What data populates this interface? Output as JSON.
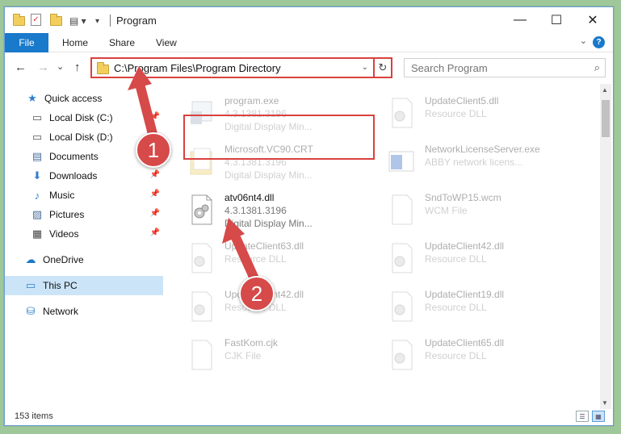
{
  "window": {
    "title": "Program",
    "minimize_glyph": "—",
    "maximize_glyph": "☐",
    "close_glyph": "✕"
  },
  "ribbon": {
    "tabs": [
      "File",
      "Home",
      "Share",
      "View"
    ],
    "help_glyph": "?",
    "accent": "#1979ca"
  },
  "nav": {
    "back_glyph": "←",
    "forward_glyph": "→",
    "recent_glyph": "⌄",
    "up_glyph": "↑",
    "address_path": "C:\\Program Files\\Program Directory",
    "refresh_glyph": "↻",
    "search_placeholder": "Search Program",
    "search_glyph": "⌕"
  },
  "sidebar": {
    "items": [
      {
        "label": "Quick access",
        "icon": "star-icon",
        "glyph": "★",
        "color": "#2f7fd1",
        "pinned": false
      },
      {
        "label": "Local Disk (C:)",
        "icon": "drive-icon",
        "glyph": "▭",
        "color": "#555555",
        "pinned": true
      },
      {
        "label": "Local Disk (D:)",
        "icon": "drive-icon",
        "glyph": "▭",
        "color": "#555555",
        "pinned": false
      },
      {
        "label": "Documents",
        "icon": "documents-icon",
        "glyph": "▤",
        "color": "#4a6f9c",
        "pinned": true
      },
      {
        "label": "Downloads",
        "icon": "downloads-icon",
        "glyph": "⬇",
        "color": "#2f7fd1",
        "pinned": true
      },
      {
        "label": "Music",
        "icon": "music-icon",
        "glyph": "♪",
        "color": "#2f7fd1",
        "pinned": true
      },
      {
        "label": "Pictures",
        "icon": "pictures-icon",
        "glyph": "▨",
        "color": "#4a6f9c",
        "pinned": true
      },
      {
        "label": "Videos",
        "icon": "videos-icon",
        "glyph": "▦",
        "color": "#444444",
        "pinned": true
      },
      {
        "label": "OneDrive",
        "icon": "cloud-icon",
        "glyph": "☁",
        "color": "#1979ca",
        "pinned": false
      },
      {
        "label": "This PC",
        "icon": "computer-icon",
        "glyph": "▭",
        "color": "#2f7fd1",
        "pinned": false,
        "selected": true
      },
      {
        "label": "Network",
        "icon": "network-icon",
        "glyph": "⛁",
        "color": "#2f7fd1",
        "pinned": false
      }
    ],
    "pin_glyph": "📌"
  },
  "files": [
    {
      "name": "program.exe",
      "line1": "4.3.1381.3196",
      "line2": "Digital Display Min...",
      "icon": "exe-icon",
      "faded": true
    },
    {
      "name": "Microsoft.VC90.CRT",
      "line1": "4.3.1381.3196",
      "line2": "Digital Display Min...",
      "icon": "folder-icon",
      "faded": true
    },
    {
      "name": "atv06nt4.dll",
      "line1": "4.3.1381.3196",
      "line2": "Digital Display Min...",
      "icon": "dll-icon",
      "faded": false
    },
    {
      "name": "UpdateClient63.dll",
      "line1": "Resource DLL",
      "line2": "",
      "icon": "dll-icon",
      "faded": true
    },
    {
      "name": "UpdateClient42.dll",
      "line1": "Resource DLL",
      "line2": "",
      "icon": "dll-icon",
      "faded": true
    },
    {
      "name": "FastKom.cjk",
      "line1": "CJK File",
      "line2": "",
      "icon": "file-icon",
      "faded": true
    },
    {
      "name": "UpdateClient5.dll",
      "line1": "Resource DLL",
      "line2": "",
      "icon": "dll-icon",
      "faded": true
    },
    {
      "name": "NetworkLicenseServer.exe",
      "line1": "ABBY network licens...",
      "line2": "",
      "icon": "exe-icon",
      "faded": true
    },
    {
      "name": "SndToWP15.wcm",
      "line1": "WCM File",
      "line2": "",
      "icon": "file-icon",
      "faded": true
    },
    {
      "name": "UpdateClient42.dll",
      "line1": "Resource DLL",
      "line2": "",
      "icon": "dll-icon",
      "faded": true
    },
    {
      "name": "UpdateClient19.dll",
      "line1": "Resource DLL",
      "line2": "",
      "icon": "dll-icon",
      "faded": true
    },
    {
      "name": "UpdateClient65.dll",
      "line1": "Resource DLL",
      "line2": "",
      "icon": "dll-icon",
      "faded": true
    }
  ],
  "status": {
    "item_count": "153 items"
  },
  "annotations": {
    "callout_1": "1",
    "callout_2": "2",
    "callout_color": "#d64a49"
  }
}
